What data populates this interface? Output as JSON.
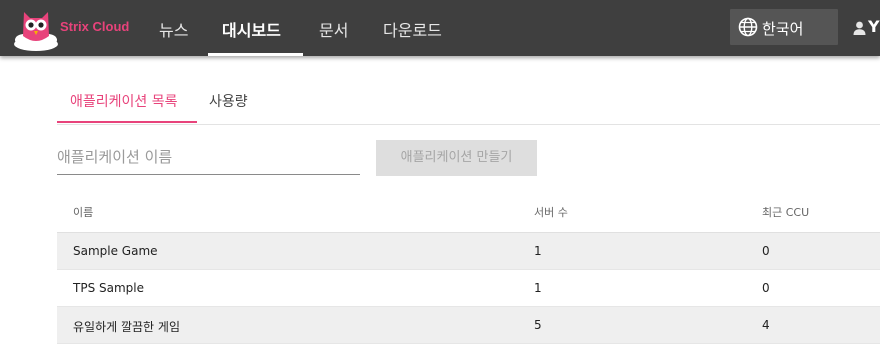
{
  "header": {
    "brand": "Strix Cloud",
    "nav": [
      {
        "label": "뉴스"
      },
      {
        "label": "대시보드"
      },
      {
        "label": "문서"
      },
      {
        "label": "다운로드"
      }
    ],
    "language": "한국어",
    "user_initial": "Y"
  },
  "tabs": [
    {
      "label": "애플리케이션 목록"
    },
    {
      "label": "사용량"
    }
  ],
  "form": {
    "name_placeholder": "애플리케이션 이름",
    "create_button": "애플리케이션 만들기"
  },
  "table": {
    "columns": [
      "이름",
      "서버 수",
      "최근 CCU"
    ],
    "rows": [
      {
        "name": "Sample Game",
        "servers": "1",
        "ccu": "0"
      },
      {
        "name": "TPS Sample",
        "servers": "1",
        "ccu": "0"
      },
      {
        "name": "유일하게 깔끔한 게임",
        "servers": "5",
        "ccu": "4"
      }
    ]
  },
  "colors": {
    "accent": "#e8437b",
    "header_bg": "#3f3f3f",
    "language_bg": "#555555"
  }
}
